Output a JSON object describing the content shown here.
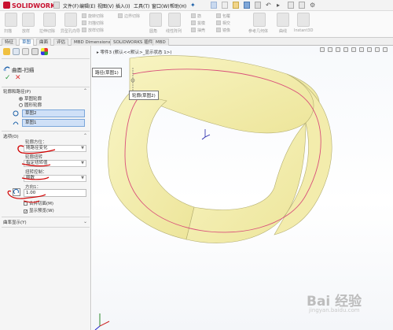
{
  "app": {
    "brand": "SOLIDWORKS"
  },
  "menu": [
    "文件(F)",
    "编辑(E)",
    "视图(V)",
    "插入(I)",
    "工具(T)",
    "窗口(W)",
    "帮助(H)"
  ],
  "ribbon": {
    "labels": [
      "扫描",
      "放样",
      "拉伸切除",
      "异型孔向导",
      "旋转切除",
      "扫描切除",
      "放样切除",
      "边界切除",
      "圆角",
      "线性阵列",
      "筋",
      "拔模",
      "抽壳",
      "包覆",
      "相交",
      "镜像",
      "参考几何体",
      "曲线",
      "Instant3D"
    ]
  },
  "tabs": [
    {
      "label": "特征",
      "active": false
    },
    {
      "label": "草图",
      "active": true
    },
    {
      "label": "曲面",
      "active": false
    },
    {
      "label": "评估",
      "active": false
    },
    {
      "label": "MBD Dimensions",
      "active": false
    },
    {
      "label": "SOLIDWORKS 插件",
      "active": false
    },
    {
      "label": "MBD",
      "active": false
    }
  ],
  "panel": {
    "title": "曲面-扫描",
    "profile_section": "轮廓和路径(P)",
    "radio_sketch": "草图轮廓",
    "radio_circle": "圆形轮廓",
    "profile_value": "草图2",
    "path_value": "草图1",
    "options_section": "选项(O)",
    "orient_label": "轮廓方位：",
    "orient_value": "随路径变化",
    "twist_label": "轮廓扭转",
    "twist_value": "指定扭转值",
    "twist_control_label": "扭转控制：",
    "twist_control_value": "圈数",
    "direction_label": "方向1：",
    "direction_value": "1.00",
    "check_merge": "合并切面(M)",
    "check_preview": "显示预览(W)",
    "curvature_section": "曲率显示(Y)"
  },
  "view": {
    "tree_text": "零件3 (默认<<默认>_显示状态 1>)",
    "callout_path": "路径(草图1)",
    "callout_profile": "轮廓(草图2)"
  },
  "watermark": {
    "main": "Bai 经验",
    "sub": "jingyan.baidu.com"
  },
  "colors": {
    "accent": "#1a5fa8",
    "surface": "#f4f0b0",
    "path": "#d94f7a",
    "ok": "#2b9a3e",
    "cancel": "#dd3333"
  }
}
